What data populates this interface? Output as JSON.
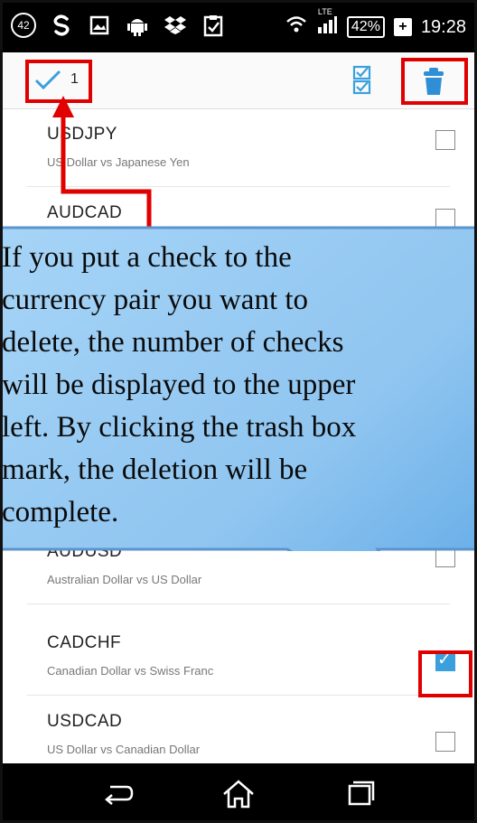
{
  "status_bar": {
    "notification_count": "42",
    "network": "LTE",
    "battery": "42%",
    "time": "19:28",
    "icons": [
      "notification-badge-icon",
      "s-app-icon",
      "gallery-icon",
      "android-icon",
      "dropbox-icon",
      "clipboard-icon"
    ]
  },
  "app_bar": {
    "selected_count": "1",
    "icons": {
      "confirm": "checkmark-icon",
      "select_all": "select-all-icon",
      "delete": "trash-icon"
    }
  },
  "currency_pairs": [
    {
      "symbol": "USDJPY",
      "description": "US Dollar vs Japanese Yen",
      "checked": false
    },
    {
      "symbol": "AUDCAD",
      "description": "",
      "checked": false
    },
    {
      "symbol": "AUDUSD",
      "description": "Australian Dollar vs US Dollar",
      "checked": false
    },
    {
      "symbol": "CADCHF",
      "description": "Canadian Dollar vs Swiss Franc",
      "checked": true
    },
    {
      "symbol": "USDCAD",
      "description": "US Dollar vs Canadian Dollar",
      "checked": false
    }
  ],
  "callout": {
    "lines": [
      "If you put a check to the",
      "currency pair you want to",
      "delete, the number of checks",
      "will be displayed to the upper",
      "left. By clicking the trash box",
      "mark, the deletion will be",
      "complete."
    ]
  },
  "nav_bar": {
    "icons": [
      "back-icon",
      "home-icon",
      "recent-apps-icon"
    ]
  },
  "colors": {
    "accent": "#3aa0dd",
    "highlight": "#e00000",
    "callout_fill": "#8fc5f0"
  }
}
